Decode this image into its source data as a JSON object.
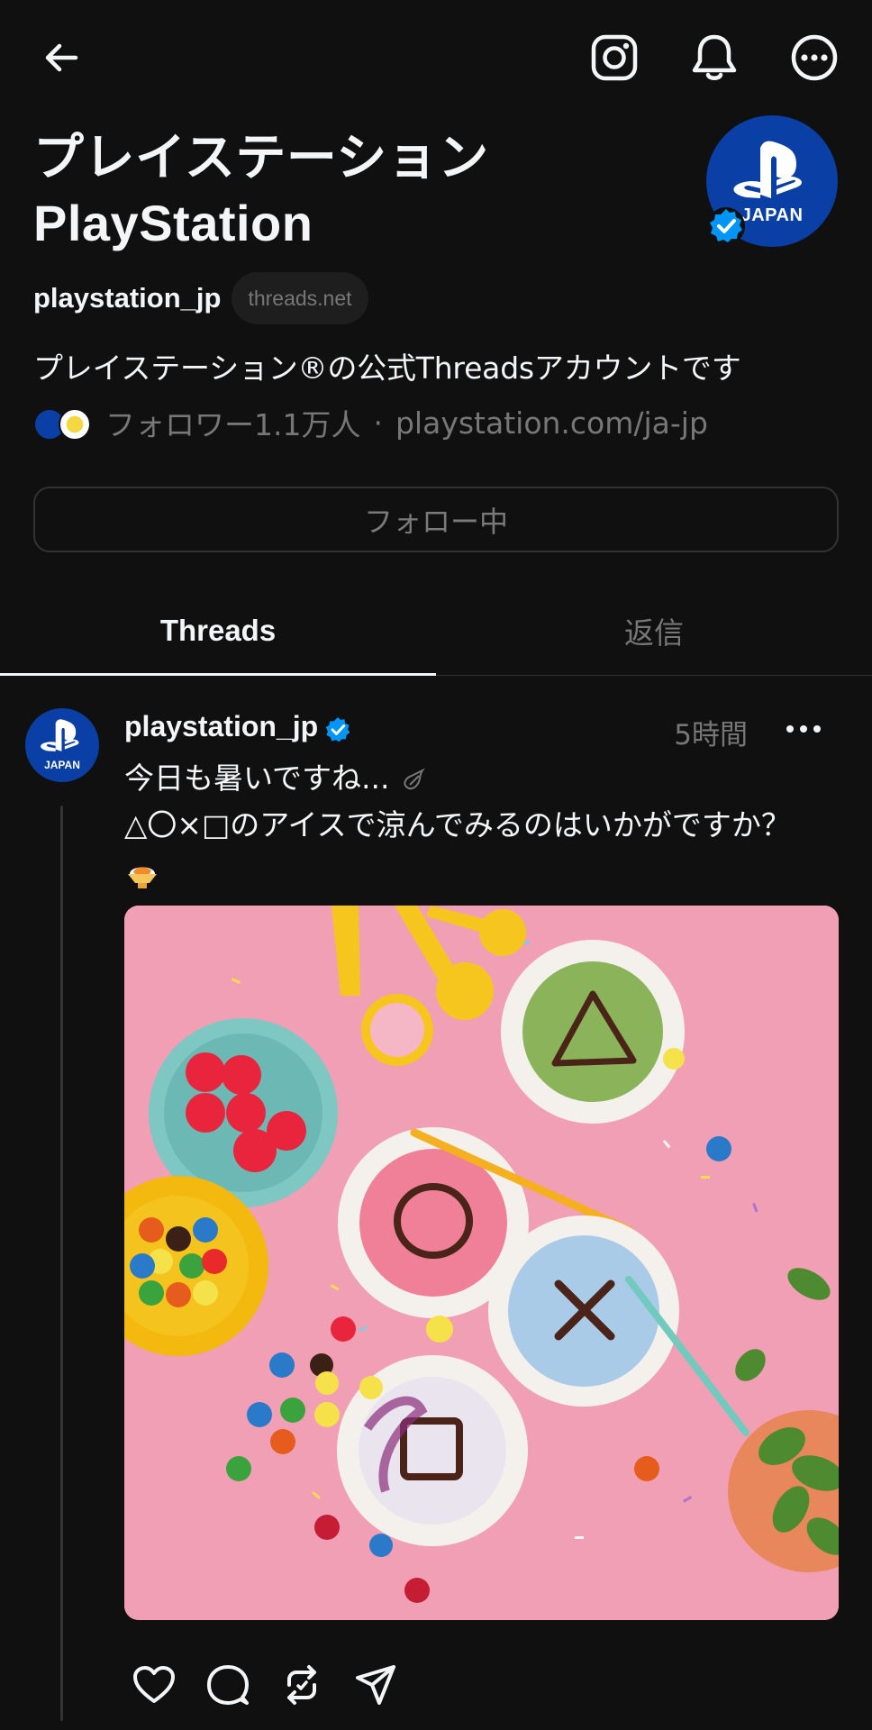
{
  "header": {
    "icons": [
      "back-arrow-icon",
      "instagram-icon",
      "bell-icon",
      "more-circle-icon"
    ]
  },
  "profile": {
    "name_ja": "プレイステーション",
    "name_en": "PlayStation",
    "avatar_label": "JAPAN",
    "handle": "playstation_jp",
    "domain": "threads.net",
    "bio": "プレイステーション®の公式Threadsアカウントです",
    "followers": "フォロワー1.1万人",
    "separator": "·",
    "link": "playstation.com/ja-jp",
    "follow_button": "フォロー中"
  },
  "tabs": [
    {
      "label": "Threads",
      "active": true
    },
    {
      "label": "返信",
      "active": false
    }
  ],
  "post": {
    "handle": "playstation_jp",
    "avatar_label": "JAPAN",
    "time": "5時間",
    "line1": "今日も暑いですね...",
    "line2": "△〇×□のアイスで涼んでみるのはいかがですか？",
    "actions": [
      "heart-icon",
      "comment-icon",
      "repost-icon",
      "share-icon"
    ]
  },
  "colors": {
    "background": "#101010",
    "text": "#f3f5f7",
    "muted": "#777777",
    "verified": "#0095f6",
    "playstation_blue": "#0a3fa5",
    "image_pink": "#f19fb4"
  }
}
